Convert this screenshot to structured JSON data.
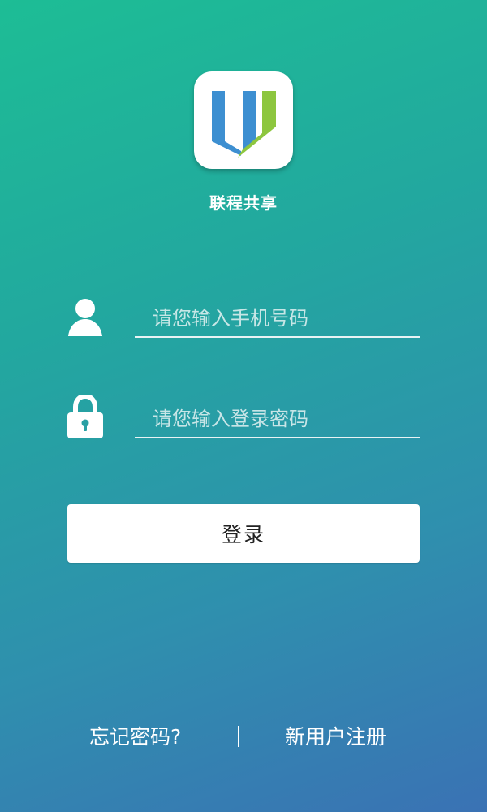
{
  "app": {
    "name": "联程共享"
  },
  "login_form": {
    "phone_placeholder": "请您输入手机号码",
    "phone_value": "",
    "password_placeholder": "请您输入登录密码",
    "password_value": "",
    "login_label": "登录"
  },
  "footer": {
    "forgot_password_label": "忘记密码?",
    "register_label": "新用户注册"
  },
  "icons": {
    "logo": "app-logo-icon",
    "phone_field": "user-icon",
    "password_field": "lock-icon"
  },
  "colors": {
    "gradient_start": "#1dbd95",
    "gradient_end": "#3a72b4",
    "logo_blue": "#3d8fd1",
    "logo_green": "#8dc63f",
    "button_bg": "#ffffff"
  }
}
